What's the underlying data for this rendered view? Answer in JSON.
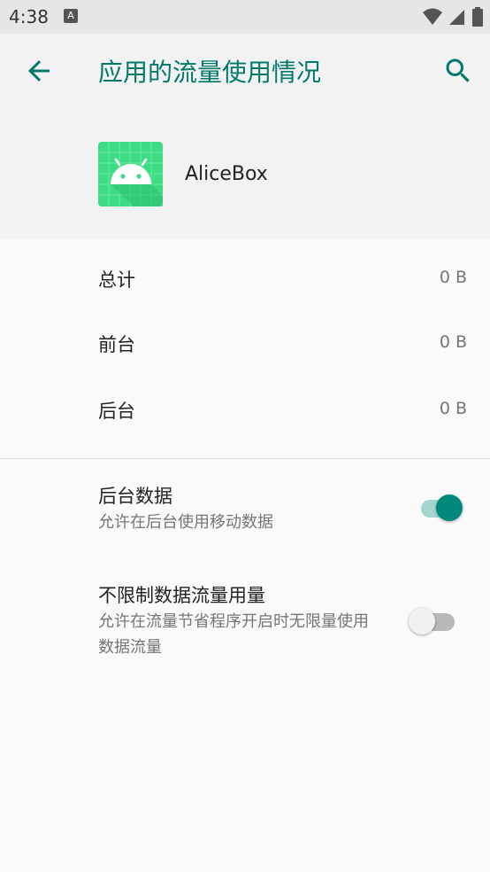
{
  "status_bar": {
    "time": "4:38",
    "notification_icon": "A"
  },
  "toolbar": {
    "title": "应用的流量使用情况",
    "back_icon": "arrow-back-icon",
    "search_icon": "search-icon"
  },
  "app": {
    "name": "AliceBox",
    "icon": "android-icon"
  },
  "usage": [
    {
      "label": "总计",
      "value": "0 B"
    },
    {
      "label": "前台",
      "value": "0 B"
    },
    {
      "label": "后台",
      "value": "0 B"
    }
  ],
  "prefs": {
    "background_data": {
      "title": "后台数据",
      "summary": "允许在后台使用移动数据",
      "enabled": true
    },
    "unrestricted": {
      "title": "不限制数据流量用量",
      "summary": "允许在流量节省程序开启时无限量使用数据流量",
      "enabled": false
    }
  },
  "colors": {
    "accent": "#00796b",
    "switch_on_thumb": "#00897b",
    "switch_on_track": "#a2d6cf"
  }
}
